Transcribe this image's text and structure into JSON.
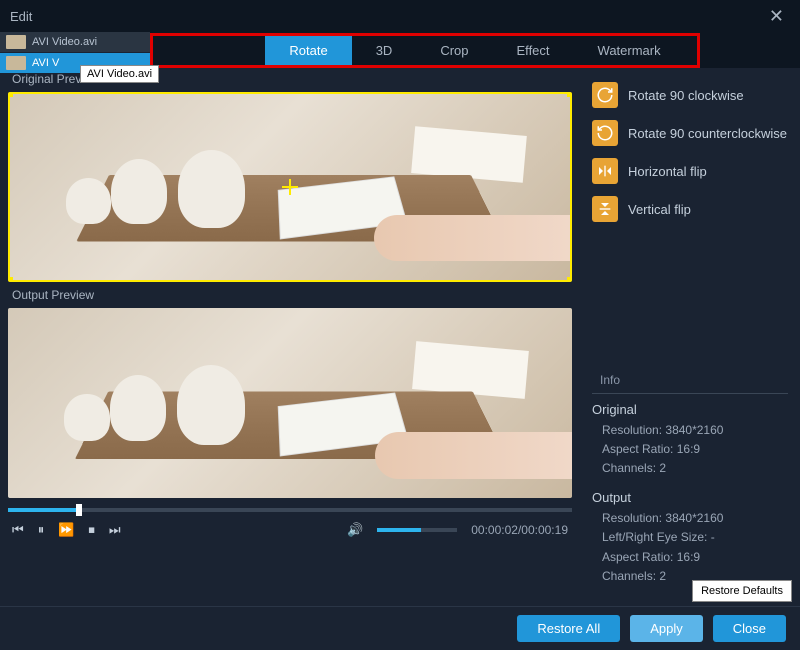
{
  "titlebar": {
    "title": "Edit"
  },
  "files": {
    "items": [
      {
        "name": "AVI Video.avi"
      },
      {
        "name": "AVI V"
      }
    ],
    "tooltip": "AVI Video.avi"
  },
  "tabs": {
    "items": [
      {
        "label": "Rotate",
        "active": true
      },
      {
        "label": "3D"
      },
      {
        "label": "Crop"
      },
      {
        "label": "Effect"
      },
      {
        "label": "Watermark"
      }
    ]
  },
  "preview": {
    "original_label": "Original Preview",
    "output_label": "Output Preview"
  },
  "rotate_options": {
    "cw": "Rotate 90 clockwise",
    "ccw": "Rotate 90 counterclockwise",
    "hflip": "Horizontal flip",
    "vflip": "Vertical flip"
  },
  "info": {
    "title": "Info",
    "original": {
      "heading": "Original",
      "resolution_label": "Resolution:",
      "resolution_value": "3840*2160",
      "aspect_label": "Aspect Ratio:",
      "aspect_value": "16:9",
      "channels_label": "Channels:",
      "channels_value": "2"
    },
    "output": {
      "heading": "Output",
      "resolution_label": "Resolution:",
      "resolution_value": "3840*2160",
      "eyesize_label": "Left/Right Eye Size:",
      "eyesize_value": "-",
      "aspect_label": "Aspect Ratio:",
      "aspect_value": "16:9",
      "channels_label": "Channels:",
      "channels_value": "2"
    }
  },
  "player": {
    "time_current": "00:00:02",
    "time_total": "00:00:19",
    "seek_percent": 12,
    "volume_percent": 55
  },
  "buttons": {
    "restore_defaults": "Restore Defaults",
    "restore_all": "Restore All",
    "apply": "Apply",
    "close": "Close"
  }
}
